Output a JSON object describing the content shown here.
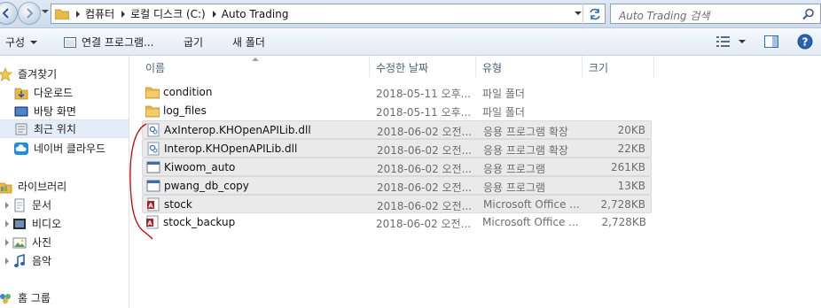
{
  "address": {
    "crumbs": [
      "컴퓨터",
      "로컬 디스크 (C:)",
      "Auto Trading"
    ]
  },
  "search": {
    "placeholder": "Auto Trading 검색"
  },
  "toolbar": {
    "organize": "구성",
    "open_with": "연결 프로그램...",
    "burn": "굽기",
    "new_folder": "새 폴더"
  },
  "nav": {
    "favorites": "즐겨찾기",
    "downloads": "다운로드",
    "desktop": "바탕 화면",
    "recent": "최근 위치",
    "naver_cloud": "네이버 클라우드",
    "libraries": "라이브러리",
    "documents": "문서",
    "videos": "비디오",
    "pictures": "사진",
    "music": "음악",
    "homegroup": "홈 그룹"
  },
  "columns": {
    "name": "이름",
    "date": "수정한 날짜",
    "type": "유형",
    "size": "크기"
  },
  "files": [
    {
      "name": "condition",
      "date": "2018-05-11 오후...",
      "type": "파일 폴더",
      "size": "",
      "icon": "folder-icon"
    },
    {
      "name": "log_files",
      "date": "2018-05-11 오후...",
      "type": "파일 폴더",
      "size": "",
      "icon": "folder-icon"
    },
    {
      "name": "AxInterop.KHOpenAPILib.dll",
      "date": "2018-06-02 오전...",
      "type": "응용 프로그램 확장",
      "size": "20KB",
      "icon": "dll-icon"
    },
    {
      "name": "Interop.KHOpenAPILib.dll",
      "date": "2018-06-02 오전...",
      "type": "응용 프로그램 확장",
      "size": "22KB",
      "icon": "dll-icon"
    },
    {
      "name": "Kiwoom_auto",
      "date": "2018-06-02 오전...",
      "type": "응용 프로그램",
      "size": "261KB",
      "icon": "exe-icon"
    },
    {
      "name": "pwang_db_copy",
      "date": "2018-06-02 오전...",
      "type": "응용 프로그램",
      "size": "13KB",
      "icon": "exe-icon"
    },
    {
      "name": "stock",
      "date": "2018-06-02 오전...",
      "type": "Microsoft Office ...",
      "size": "2,728KB",
      "icon": "access-db-icon"
    },
    {
      "name": "stock_backup",
      "date": "2018-06-02 오전...",
      "type": "Microsoft Office ...",
      "size": "2,728KB",
      "icon": "access-db-icon"
    }
  ],
  "colors": {
    "selection": "#eaeaea",
    "annotation": "#cc0000",
    "folder": "#e8b84a"
  }
}
